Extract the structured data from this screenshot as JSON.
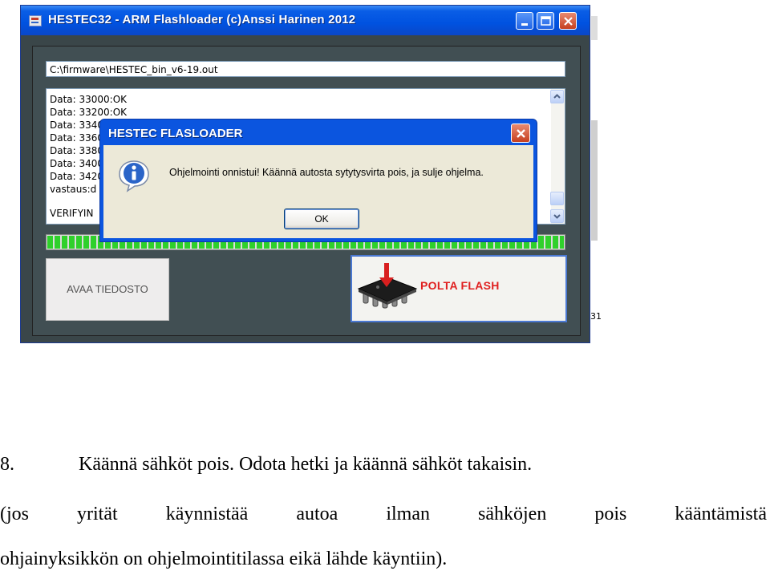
{
  "window": {
    "title": "HESTEC32 - ARM Flashloader (c)Anssi Harinen 2012",
    "icon": "app-icon",
    "controls": [
      "minimize-icon",
      "maximize-icon",
      "close-icon"
    ]
  },
  "path_field": {
    "value": "C:\\firmware\\HESTEC_bin_v6-19.out"
  },
  "log": {
    "lines": [
      "Data: 33000:OK",
      "Data: 33200:OK",
      "Data: 3340",
      "Data: 3360",
      "Data: 3380",
      "Data: 3400",
      "Data: 3420",
      "vastaus:d",
      "VERIFYIN"
    ]
  },
  "progress": {
    "value": 1.0
  },
  "buttons": {
    "open_label": "AVAA TIEDOSTO",
    "flash_label": "POLTA FLASH"
  },
  "edge_fragment": "31",
  "dialog": {
    "title": "HESTEC FLASLOADER",
    "message": "Ohjelmointi onnistui! Käännä autosta sytytysvirta pois, ja sulje ohjelma.",
    "ok_label": "OK",
    "icon": "info-icon"
  },
  "document": {
    "step_number": "8.",
    "step_text": "Käännä sähköt pois. Odota hetki ja käännä sähköt takaisin.",
    "note_line1": "(jos yrität käynnistää autoa ilman sähköjen pois kääntämistä",
    "note_line2": "ohjainyksikkön on ohjelmointitilassa eikä lähde käyntiin)."
  }
}
